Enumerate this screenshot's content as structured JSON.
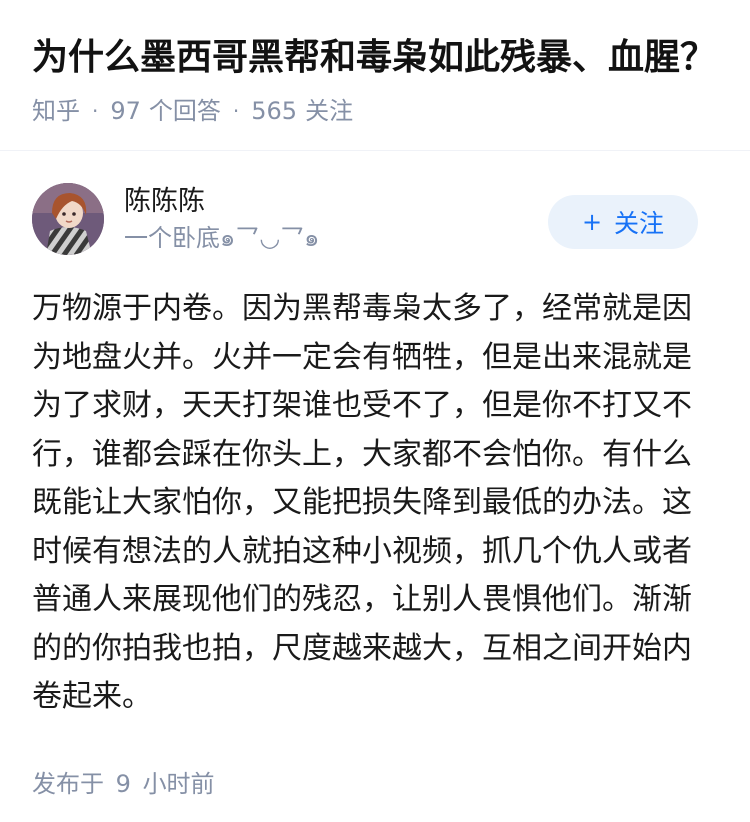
{
  "question": {
    "title": "为什么墨西哥黑帮和毒枭如此残暴、血腥？",
    "source": "知乎",
    "answer_count": "97",
    "answer_suffix": "个回答",
    "follower_count": "565",
    "follower_suffix": "关注"
  },
  "author": {
    "name": "陈陈陈",
    "bio": "一个卧底๑乛◡乛๑",
    "follow_label": "关注",
    "follow_icon": "plus-icon"
  },
  "answer": {
    "text": "万物源于内卷。因为黑帮毒枭太多了，经常就是因为地盘火并。火并一定会有牺牲，但是出来混就是为了求财，天天打架谁也受不了，但是你不打又不行，谁都会踩在你头上，大家都不会怕你。有什么既能让大家怕你，又能把损失降到最低的办法。这时候有想法的人就拍这种小视频，抓几个仇人或者普通人来展现他们的残忍，让别人畏惧他们。渐渐的的你拍我也拍，尺度越来越大，互相之间开始内卷起来。",
    "published_prefix": "发布于",
    "published_number": "9",
    "published_suffix": "小时前"
  },
  "colors": {
    "title": "#121212",
    "meta": "#8590a6",
    "accent": "#1772f6",
    "follow_bg": "#eaf2fb"
  }
}
